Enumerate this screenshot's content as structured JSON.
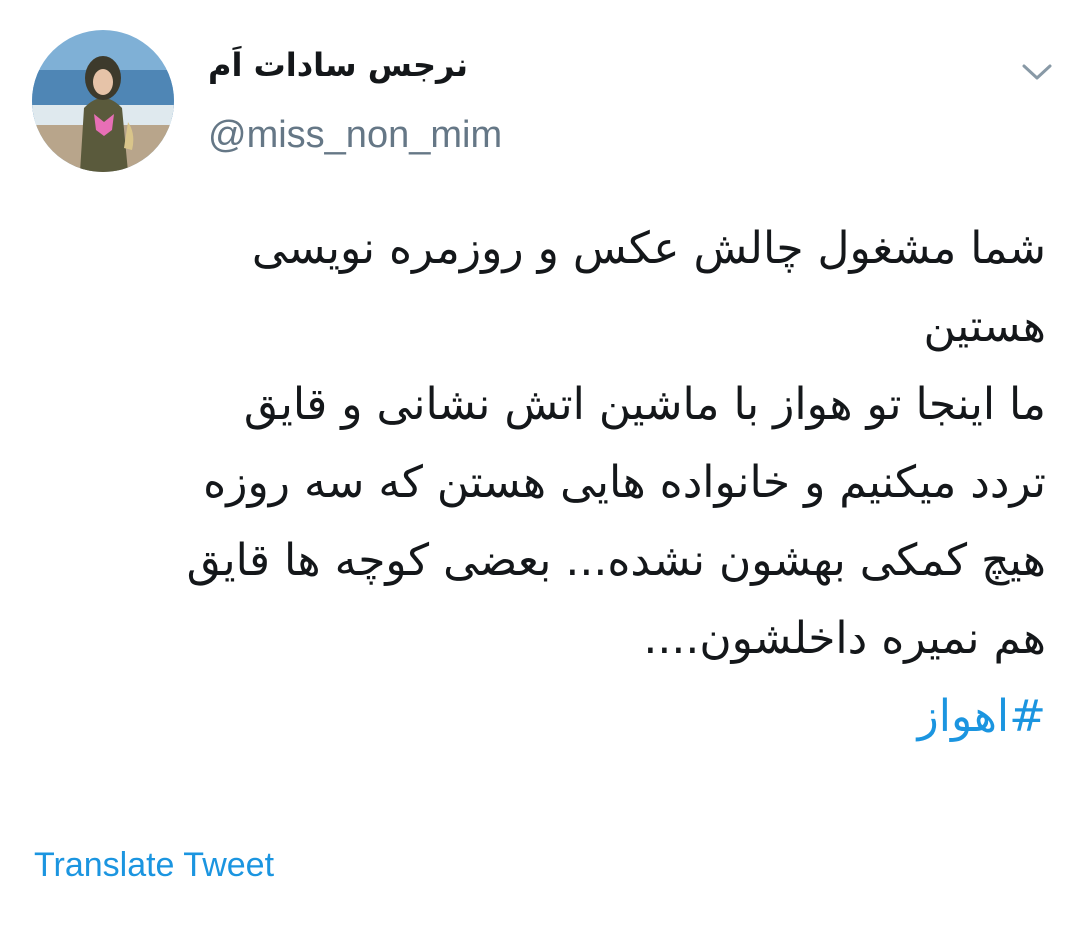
{
  "author": {
    "display_name": "نرجس سادات اَم",
    "handle": "@miss_non_mim",
    "avatar_icon": "profile-photo"
  },
  "menu": {
    "icon": "chevron-down-icon"
  },
  "tweet": {
    "lines": [
      "شما مشغول چالش عکس و روزمره نویسی",
      "هستین",
      "ما اینجا تو هواز با ماشین اتش نشانی و قایق",
      "تردد میکنیم و خانواده هایی هستن که سه روزه",
      "هیچ کمکی بهشون نشده... بعضی کوچه ها قایق",
      "هم نمیره داخلشون...."
    ],
    "hashtag": "#اهواز"
  },
  "actions": {
    "translate_label": "Translate Tweet"
  },
  "colors": {
    "link": "#1b95e0",
    "text": "#14171a",
    "secondary": "#657786"
  }
}
